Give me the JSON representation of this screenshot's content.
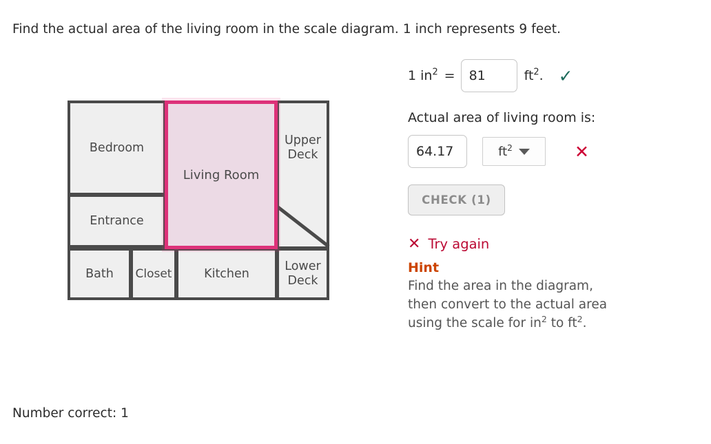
{
  "prompt": "Find the actual area of the living room in the scale diagram. 1 inch represents 9 feet.",
  "diagram": {
    "rooms": [
      {
        "name": "bedroom",
        "label": "Bedroom"
      },
      {
        "name": "entrance",
        "label": "Entrance"
      },
      {
        "name": "bath",
        "label": "Bath"
      },
      {
        "name": "closet",
        "label": "Closet"
      },
      {
        "name": "kitchen",
        "label": "Kitchen"
      },
      {
        "name": "upper-deck",
        "label": "Upper\nDeck",
        "line1": "Upper",
        "line2": "Deck"
      },
      {
        "name": "lower-deck",
        "label": "Lower\nDeck",
        "line1": "Lower",
        "line2": "Deck"
      }
    ],
    "highlighted_room": "Living Room",
    "highlight_color": "#dd3179",
    "highlight_fill": "#ecdae5",
    "wall_color": "#4a4a4a",
    "room_fill": "#efefef"
  },
  "panel": {
    "scale_row": {
      "prefix": "1 in",
      "prefix_sup": "2",
      "equals": "=",
      "input_value": "81",
      "suffix": "ft",
      "suffix_sup": "2",
      "suffix_tail": ".",
      "status_icon": "check-icon",
      "status_glyph": "✓",
      "status_color": "#1d6b5b"
    },
    "answer_label": "Actual area of living room is:",
    "answer_value": "64.17",
    "unit_select": {
      "value": "ft",
      "value_sup": "2",
      "caret_icon": "chevron-down-icon"
    },
    "answer_status_icon": "x-icon",
    "answer_status_glyph": "✕",
    "answer_status_color": "#cc0033",
    "check_button_label": "CHECK (1)",
    "feedback": {
      "icon": "x-icon",
      "glyph": "✕",
      "text": "Try again",
      "color": "#bb0a34"
    },
    "hint_title": "Hint",
    "hint_color": "#cc4400",
    "hint_line1": "Find the area in the diagram,",
    "hint_line2": "then convert to the actual area",
    "hint_line3_a": "using the scale for in",
    "hint_line3_sup1": "2",
    "hint_line3_b": " to ft",
    "hint_line3_sup2": "2",
    "hint_line3_c": "."
  },
  "footer": "Number correct: 1"
}
